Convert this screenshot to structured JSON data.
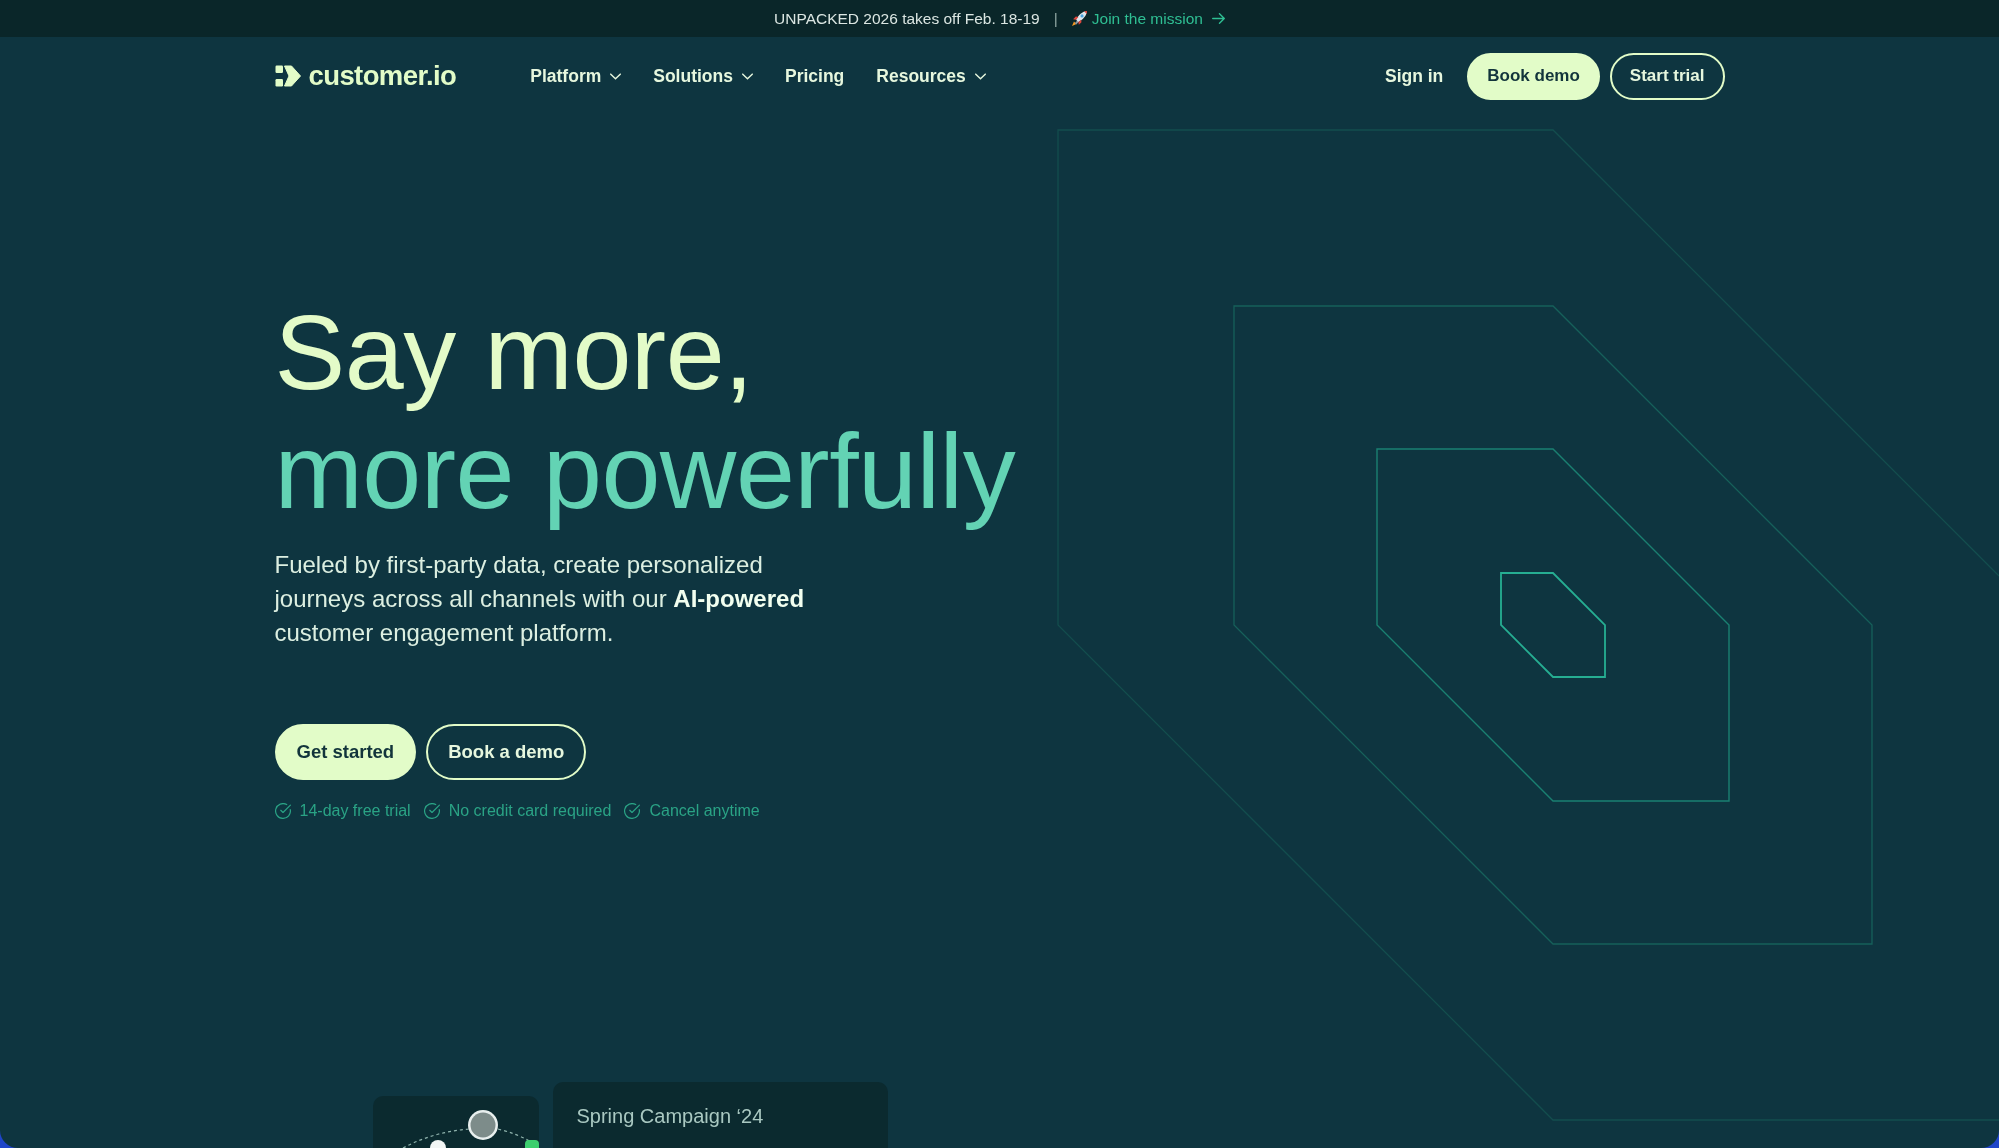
{
  "banner": {
    "text": "UNPACKED 2026 takes off Feb. 18-19",
    "separator": "|",
    "link": "Join the mission"
  },
  "header": {
    "logo": "customer.io",
    "nav": [
      {
        "label": "Platform",
        "dropdown": true
      },
      {
        "label": "Solutions",
        "dropdown": true
      },
      {
        "label": "Pricing",
        "dropdown": false
      },
      {
        "label": "Resources",
        "dropdown": true
      }
    ],
    "sign_in": "Sign in",
    "buttons": [
      {
        "label": "Book demo",
        "kind": "primary"
      },
      {
        "label": "Start trial",
        "kind": "outline"
      }
    ]
  },
  "hero": {
    "headline": [
      {
        "text": "Say more,",
        "kind": "plain"
      },
      {
        "text": "more powerfully",
        "kind": "accent"
      }
    ],
    "description": "Fueled by first-party data, create personalized journeys across all channels with our **AI-powered** customer engagement platform.",
    "buttons": [
      {
        "label": "Get started",
        "kind": "primary"
      },
      {
        "label": "Book a demo",
        "kind": "outline"
      }
    ],
    "perks": [
      "14-day free trial",
      "No credit card required",
      "Cancel anytime"
    ]
  },
  "preview": {
    "campaign_title": "Spring Campaign ‘24"
  }
}
